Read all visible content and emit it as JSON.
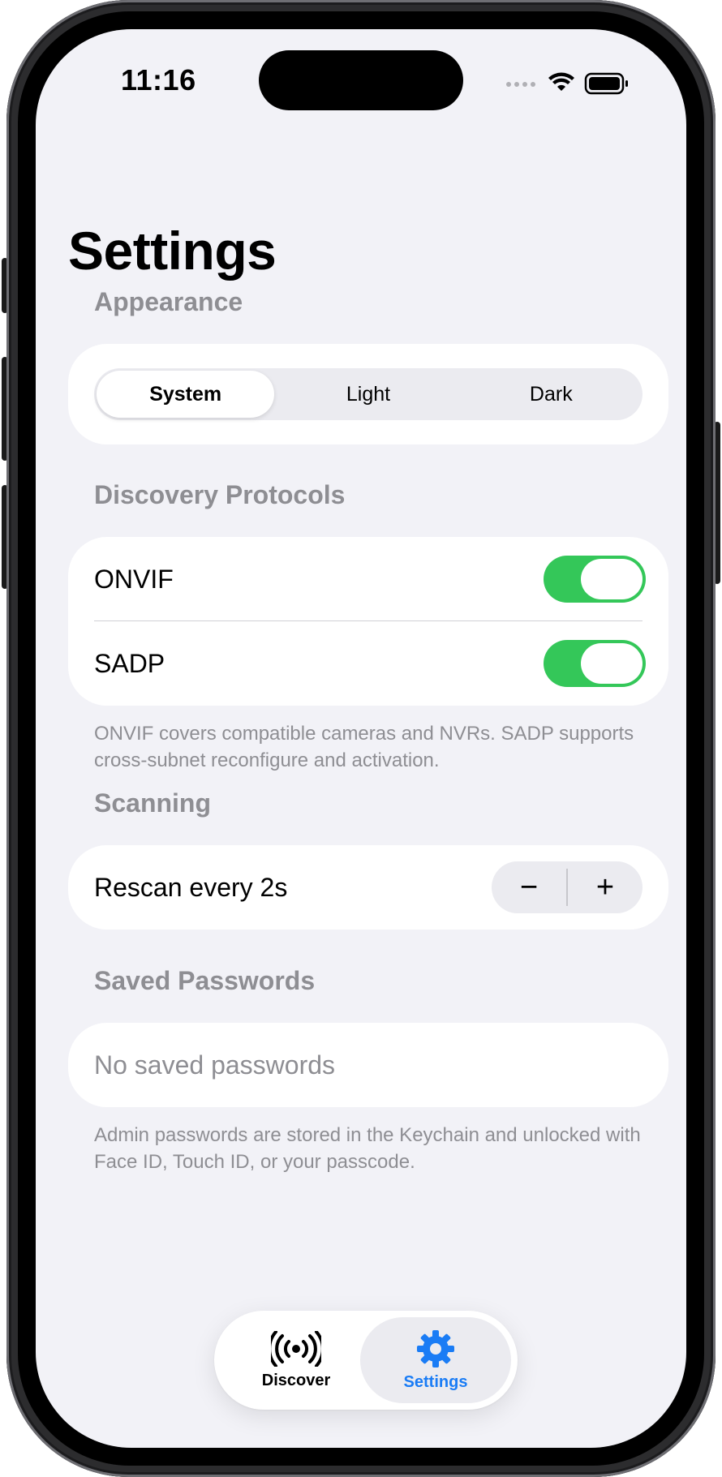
{
  "status_bar": {
    "time": "11:16"
  },
  "page": {
    "title": "Settings"
  },
  "appearance": {
    "header": "Appearance",
    "options": [
      "System",
      "Light",
      "Dark"
    ],
    "selected": "System"
  },
  "discovery": {
    "header": "Discovery Protocols",
    "protocols": [
      {
        "label": "ONVIF",
        "enabled": true
      },
      {
        "label": "SADP",
        "enabled": true
      }
    ],
    "footnote": "ONVIF covers compatible cameras and NVRs. SADP supports cross-subnet reconfigure and activation."
  },
  "scanning": {
    "header": "Scanning",
    "rescan_label": "Rescan every 2s",
    "decrement": "−",
    "increment": "+"
  },
  "passwords": {
    "header": "Saved Passwords",
    "empty_text": "No saved passwords",
    "footnote": "Admin passwords are stored in the Keychain and unlocked with Face ID, Touch ID, or your passcode."
  },
  "tab_bar": {
    "tabs": [
      {
        "label": "Discover",
        "icon": "antenna-broadcast-icon",
        "selected": false
      },
      {
        "label": "Settings",
        "icon": "gear-icon",
        "selected": true
      }
    ]
  },
  "colors": {
    "accent": "#1a7cf5",
    "toggle_on": "#34c759",
    "background": "#f2f2f7",
    "secondary_text": "#8e8e93"
  }
}
